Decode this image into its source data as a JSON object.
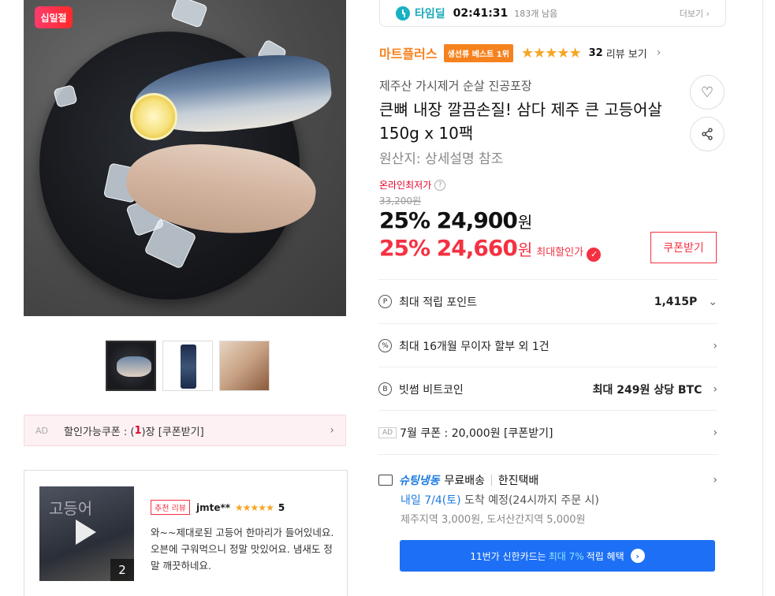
{
  "gallery": {
    "badge": "십일절",
    "main_alt": "main-product-image",
    "thumbnails": [
      "thumb-1",
      "thumb-2",
      "thumb-3"
    ]
  },
  "coupon_bar": {
    "ad": "AD",
    "text_before": "할인가능쿠폰 : (",
    "count": "1",
    "text_after": ")장 [쿠폰받기]"
  },
  "review": {
    "badge": "추천 리뷰",
    "user": "jmte**",
    "stars": "★★★★★",
    "score": "5",
    "image_caption": "고등어",
    "image_count": "2",
    "text": "와~~제대로된 고등어 한마리가 들어있네요. 오븐에 구워먹으니 정말 맛있어요. 냄새도 정말 깨끗하네요."
  },
  "deal": {
    "label": "타임딜",
    "timer": "02:41:31",
    "remaining": "183개 남음",
    "more": "더보기 ›"
  },
  "seller": {
    "name": "마트플러스",
    "best_badge": "생선류 베스트 1위",
    "stars": "★★★★★",
    "review_count": "32",
    "review_link": "리뷰 보기"
  },
  "product": {
    "subtitle": "제주산 가시제거 순살 진공포장",
    "title": "큰뼈 내장 깔끔손질! 삼다 제주 큰 고등어살 150g x 10팩",
    "origin": "원산지:  상세설명 참조"
  },
  "price": {
    "lowest_label": "온라인최저가",
    "original": "33,200원",
    "discount1": "25%",
    "price1": "24,900",
    "won": "원",
    "discount2": "25%",
    "price2": "24,660",
    "max_label": "최대할인가",
    "coupon_button": "쿠폰받기"
  },
  "rows": {
    "points_label": "최대 적립 포인트",
    "points_value": "1,415P",
    "installment_label": "최대 16개월 무이자 할부 외 1건",
    "bitcoin_label": "빗썸 비트코인",
    "bitcoin_value": "최대 249원 상당 BTC",
    "coupon_ad": "AD",
    "coupon_label": "7월 쿠폰 : 20,000원 [쿠폰받기]"
  },
  "shipping": {
    "brand": "슈팅냉동",
    "free": "무료배송",
    "carrier": "한진택배",
    "arrival": "내일 7/4(토)",
    "arrival_suffix": " 도착 예정",
    "arrival_note": "(24시까지 주문 시)",
    "extra": "제주지역 3,000원, 도서산간지역 5,000원"
  },
  "banner": {
    "prefix": "11번가 신한카드는",
    "highlight": "최대 7%",
    "suffix": "적립 혜택"
  },
  "colors": {
    "accent_red": "#f43142",
    "seller_orange": "#f6821f",
    "deal_teal": "#17a8ba",
    "banner_blue": "#1d70f5"
  }
}
